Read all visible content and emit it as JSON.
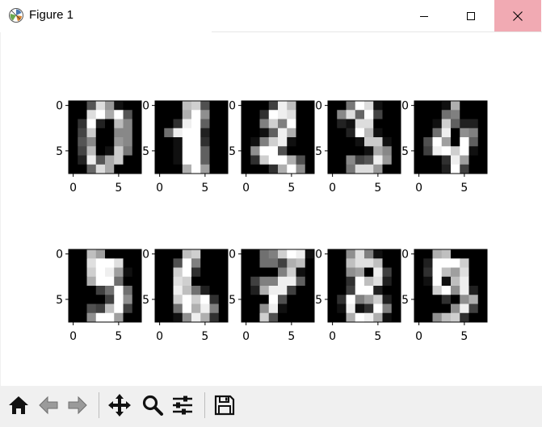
{
  "window": {
    "title": "Figure 1",
    "app_icon": "matplotlib-icon",
    "controls": [
      "minimize-icon",
      "maximize-icon",
      "close-icon"
    ],
    "close_hover_color": "#f1aab3"
  },
  "toolbar": {
    "buttons": [
      {
        "name": "home",
        "icon": "home-icon"
      },
      {
        "name": "back",
        "icon": "arrow-left-icon"
      },
      {
        "name": "forward",
        "icon": "arrow-right-icon"
      },
      {
        "name": "pan",
        "icon": "move-icon"
      },
      {
        "name": "zoom",
        "icon": "magnifier-icon"
      },
      {
        "name": "configure-subplots",
        "icon": "sliders-icon"
      },
      {
        "name": "save",
        "icon": "floppy-disk-icon"
      }
    ]
  },
  "chart_data": {
    "type": "heatmap",
    "colormap": "gray",
    "grid": false,
    "subplots": [
      {
        "digit": "0",
        "xticks": [
          "0",
          "5"
        ],
        "yticks": [
          "0",
          "5"
        ],
        "values": [
          [
            0,
            0,
            5,
            13,
            9,
            1,
            0,
            0
          ],
          [
            0,
            0,
            13,
            15,
            10,
            15,
            5,
            0
          ],
          [
            0,
            3,
            15,
            2,
            0,
            11,
            8,
            0
          ],
          [
            0,
            4,
            12,
            0,
            0,
            8,
            8,
            0
          ],
          [
            0,
            5,
            8,
            0,
            0,
            9,
            8,
            0
          ],
          [
            0,
            4,
            11,
            0,
            1,
            12,
            7,
            0
          ],
          [
            0,
            2,
            14,
            5,
            10,
            12,
            0,
            0
          ],
          [
            0,
            0,
            6,
            13,
            10,
            0,
            0,
            0
          ]
        ]
      },
      {
        "digit": "1",
        "xticks": [
          "0",
          "5"
        ],
        "yticks": [
          "0",
          "5"
        ],
        "values": [
          [
            0,
            0,
            0,
            12,
            13,
            5,
            0,
            0
          ],
          [
            0,
            0,
            0,
            11,
            16,
            9,
            0,
            0
          ],
          [
            0,
            0,
            3,
            15,
            16,
            6,
            0,
            0
          ],
          [
            0,
            7,
            15,
            16,
            16,
            2,
            0,
            0
          ],
          [
            0,
            0,
            1,
            16,
            16,
            3,
            0,
            0
          ],
          [
            0,
            0,
            1,
            16,
            16,
            6,
            0,
            0
          ],
          [
            0,
            0,
            1,
            16,
            16,
            6,
            0,
            0
          ],
          [
            0,
            0,
            0,
            11,
            16,
            10,
            0,
            0
          ]
        ]
      },
      {
        "digit": "2",
        "xticks": [
          "0",
          "5"
        ],
        "yticks": [
          "0",
          "5"
        ],
        "values": [
          [
            0,
            0,
            0,
            4,
            15,
            12,
            0,
            0
          ],
          [
            0,
            0,
            3,
            16,
            15,
            14,
            0,
            0
          ],
          [
            0,
            0,
            8,
            13,
            8,
            16,
            0,
            0
          ],
          [
            0,
            0,
            1,
            6,
            15,
            11,
            0,
            0
          ],
          [
            0,
            1,
            8,
            13,
            15,
            1,
            0,
            0
          ],
          [
            0,
            9,
            16,
            16,
            5,
            0,
            0,
            0
          ],
          [
            0,
            3,
            13,
            16,
            16,
            11,
            5,
            0
          ],
          [
            0,
            0,
            0,
            3,
            11,
            16,
            9,
            0
          ]
        ]
      },
      {
        "digit": "3",
        "xticks": [
          "0",
          "5"
        ],
        "yticks": [
          "0",
          "5"
        ],
        "values": [
          [
            0,
            0,
            7,
            15,
            13,
            1,
            0,
            0
          ],
          [
            0,
            8,
            13,
            6,
            15,
            4,
            0,
            0
          ],
          [
            0,
            2,
            1,
            13,
            13,
            0,
            0,
            0
          ],
          [
            0,
            0,
            2,
            15,
            11,
            1,
            0,
            0
          ],
          [
            0,
            0,
            0,
            1,
            12,
            12,
            1,
            0
          ],
          [
            0,
            0,
            0,
            0,
            1,
            10,
            8,
            0
          ],
          [
            0,
            0,
            8,
            4,
            5,
            14,
            9,
            0
          ],
          [
            0,
            0,
            7,
            13,
            13,
            9,
            0,
            0
          ]
        ]
      },
      {
        "digit": "4",
        "xticks": [
          "0",
          "5"
        ],
        "yticks": [
          "0",
          "5"
        ],
        "values": [
          [
            0,
            0,
            0,
            1,
            11,
            0,
            0,
            0
          ],
          [
            0,
            0,
            0,
            7,
            8,
            0,
            0,
            0
          ],
          [
            0,
            0,
            1,
            13,
            6,
            2,
            2,
            0
          ],
          [
            0,
            0,
            7,
            15,
            0,
            9,
            8,
            0
          ],
          [
            0,
            5,
            16,
            10,
            0,
            16,
            6,
            0
          ],
          [
            0,
            4,
            15,
            16,
            13,
            16,
            1,
            0
          ],
          [
            0,
            0,
            0,
            3,
            15,
            10,
            0,
            0
          ],
          [
            0,
            0,
            0,
            2,
            16,
            4,
            0,
            0
          ]
        ]
      },
      {
        "digit": "5",
        "xticks": [
          "0",
          "5"
        ],
        "yticks": [
          "0",
          "5"
        ],
        "values": [
          [
            0,
            0,
            12,
            10,
            0,
            0,
            0,
            0
          ],
          [
            0,
            0,
            14,
            16,
            16,
            14,
            0,
            0
          ],
          [
            0,
            0,
            13,
            16,
            15,
            10,
            1,
            0
          ],
          [
            0,
            0,
            11,
            16,
            16,
            7,
            0,
            0
          ],
          [
            0,
            0,
            0,
            4,
            7,
            16,
            7,
            0
          ],
          [
            0,
            0,
            0,
            0,
            4,
            16,
            9,
            0
          ],
          [
            0,
            0,
            5,
            4,
            12,
            16,
            4,
            0
          ],
          [
            0,
            0,
            9,
            16,
            16,
            10,
            0,
            0
          ]
        ]
      },
      {
        "digit": "6",
        "xticks": [
          "0",
          "5"
        ],
        "yticks": [
          "0",
          "5"
        ],
        "values": [
          [
            0,
            0,
            0,
            12,
            13,
            0,
            0,
            0
          ],
          [
            0,
            0,
            5,
            16,
            8,
            0,
            0,
            0
          ],
          [
            0,
            0,
            13,
            16,
            3,
            0,
            0,
            0
          ],
          [
            0,
            0,
            14,
            13,
            0,
            0,
            0,
            0
          ],
          [
            0,
            0,
            15,
            12,
            7,
            2,
            0,
            0
          ],
          [
            0,
            0,
            13,
            16,
            13,
            16,
            3,
            0
          ],
          [
            0,
            0,
            7,
            16,
            11,
            15,
            8,
            0
          ],
          [
            0,
            0,
            1,
            9,
            15,
            11,
            3,
            0
          ]
        ]
      },
      {
        "digit": "7",
        "xticks": [
          "0",
          "5"
        ],
        "yticks": [
          "0",
          "5"
        ],
        "values": [
          [
            0,
            0,
            7,
            8,
            13,
            16,
            15,
            1
          ],
          [
            0,
            0,
            7,
            7,
            4,
            11,
            12,
            0
          ],
          [
            0,
            0,
            0,
            0,
            8,
            13,
            1,
            0
          ],
          [
            0,
            4,
            8,
            8,
            15,
            15,
            6,
            0
          ],
          [
            0,
            2,
            11,
            15,
            15,
            4,
            0,
            0
          ],
          [
            0,
            0,
            0,
            16,
            5,
            0,
            0,
            0
          ],
          [
            0,
            0,
            9,
            15,
            1,
            0,
            0,
            0
          ],
          [
            0,
            0,
            13,
            5,
            0,
            0,
            0,
            0
          ]
        ]
      },
      {
        "digit": "8",
        "xticks": [
          "0",
          "5"
        ],
        "yticks": [
          "0",
          "5"
        ],
        "values": [
          [
            0,
            0,
            9,
            14,
            8,
            1,
            0,
            0
          ],
          [
            0,
            0,
            12,
            14,
            14,
            12,
            0,
            0
          ],
          [
            0,
            0,
            9,
            10,
            0,
            15,
            4,
            0
          ],
          [
            0,
            0,
            3,
            16,
            12,
            14,
            2,
            0
          ],
          [
            0,
            0,
            4,
            16,
            16,
            2,
            0,
            0
          ],
          [
            0,
            3,
            16,
            8,
            10,
            13,
            2,
            0
          ],
          [
            0,
            1,
            15,
            1,
            3,
            16,
            8,
            0
          ],
          [
            0,
            0,
            11,
            16,
            15,
            11,
            1,
            0
          ]
        ]
      },
      {
        "digit": "9",
        "xticks": [
          "0",
          "5"
        ],
        "yticks": [
          "0",
          "5"
        ],
        "values": [
          [
            0,
            0,
            11,
            12,
            0,
            0,
            0,
            0
          ],
          [
            0,
            2,
            16,
            16,
            16,
            13,
            0,
            0
          ],
          [
            0,
            3,
            16,
            12,
            10,
            14,
            0,
            0
          ],
          [
            0,
            1,
            16,
            1,
            12,
            15,
            0,
            0
          ],
          [
            0,
            0,
            13,
            16,
            9,
            15,
            2,
            0
          ],
          [
            0,
            0,
            0,
            3,
            0,
            9,
            11,
            0
          ],
          [
            0,
            0,
            0,
            0,
            9,
            15,
            4,
            0
          ],
          [
            0,
            0,
            9,
            12,
            13,
            3,
            0,
            0
          ]
        ]
      }
    ]
  }
}
